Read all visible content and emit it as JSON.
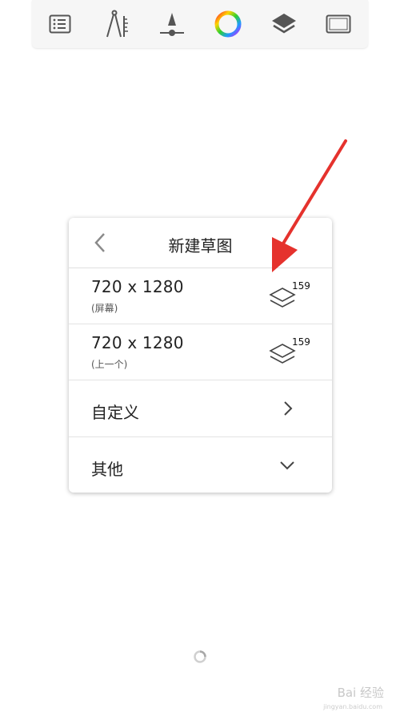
{
  "toolbar": {
    "icons": [
      "list-icon",
      "ruler-compass-icon",
      "brush-size-icon",
      "color-wheel-icon",
      "layers-icon",
      "frame-icon"
    ]
  },
  "dialog": {
    "title": "新建草图",
    "rows": [
      {
        "size": "720 x 1280",
        "sub": "(屏幕)",
        "layers": "159"
      },
      {
        "size": "720 x 1280",
        "sub": "(上一个)",
        "layers": "159"
      }
    ],
    "custom_label": "自定义",
    "other_label": "其他"
  },
  "watermark": {
    "text": "Bai 经验",
    "sub": "jingyan.baidu.com"
  },
  "colors": {
    "annotation": "#e5322d",
    "accent": "#555555"
  }
}
